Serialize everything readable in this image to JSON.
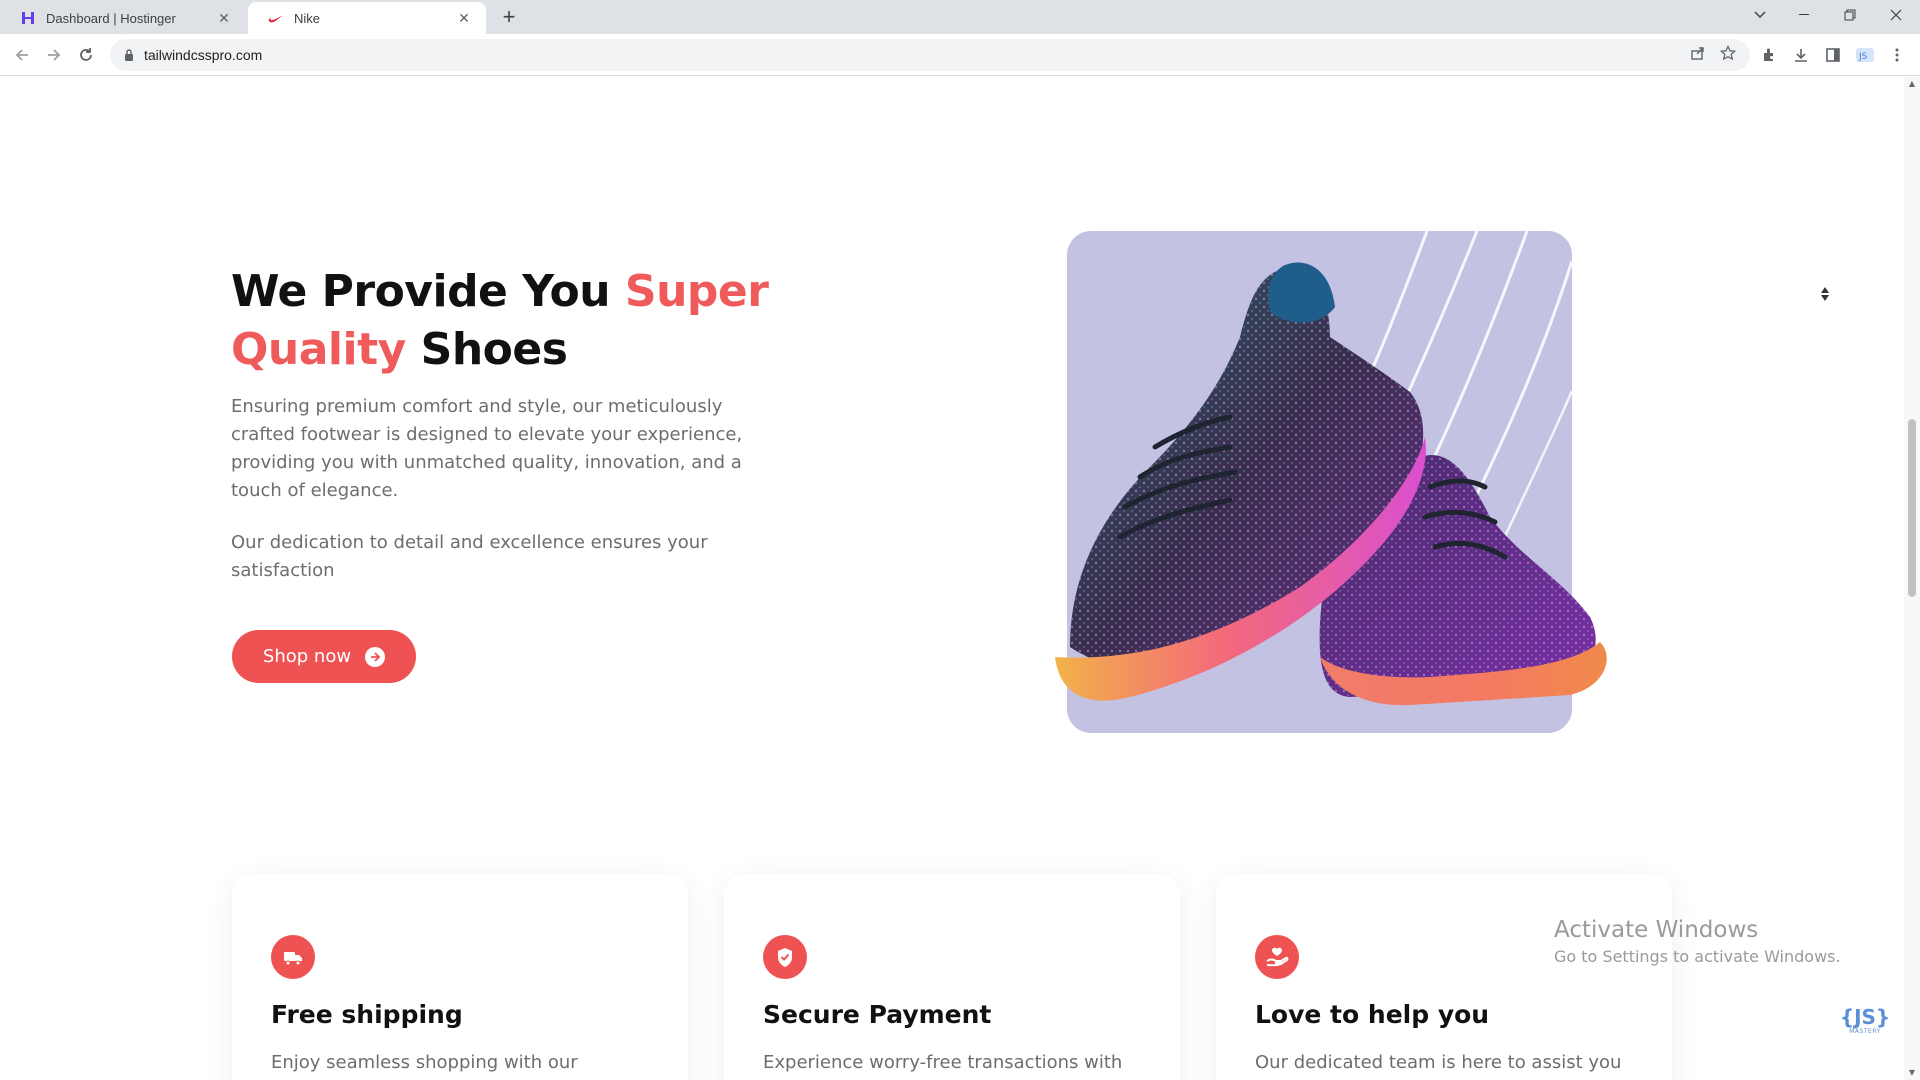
{
  "browser": {
    "tabs": [
      {
        "title": "Dashboard | Hostinger",
        "favicon": "hostinger-icon",
        "active": false
      },
      {
        "title": "Nike",
        "favicon": "nike-swoosh-icon",
        "active": true
      }
    ],
    "url": "tailwindcsspro.com"
  },
  "hero": {
    "title_part1": "We Provide You ",
    "title_accent1": "Super",
    "title_accent2": "Quality",
    "title_part2": " Shoes",
    "paragraph1": "Ensuring premium comfort and style, our meticulously crafted footwear is designed to elevate your experience, providing you with unmatched quality, innovation, and a touch of elegance.",
    "paragraph2": "Our dedication to detail and excellence ensures your satisfaction",
    "button_label": "Shop now",
    "accent_color": "#ef5252"
  },
  "features": [
    {
      "icon": "truck-icon",
      "title": "Free shipping",
      "description": "Enjoy seamless shopping with our"
    },
    {
      "icon": "shield-check-icon",
      "title": "Secure Payment",
      "description": "Experience worry-free transactions with"
    },
    {
      "icon": "hand-heart-icon",
      "title": "Love to help you",
      "description": "Our dedicated team is here to assist you"
    }
  ],
  "os_watermark": {
    "line1": "Activate Windows",
    "line2": "Go to Settings to activate Windows."
  },
  "corner_logo": {
    "text": "{JS}",
    "sub": "MASTERY"
  }
}
